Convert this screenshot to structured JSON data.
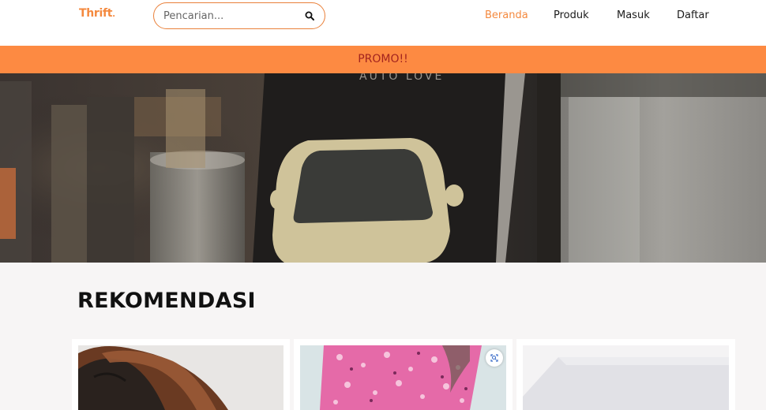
{
  "brand": {
    "name": "Thrift",
    "dot": ".",
    "color": "#f4893e"
  },
  "search": {
    "placeholder": "Pencarian...",
    "value": "",
    "icon": "search-icon"
  },
  "nav": {
    "items": [
      {
        "label": "Beranda",
        "active": true
      },
      {
        "label": "Produk",
        "active": false
      },
      {
        "label": "Masuk",
        "active": false
      },
      {
        "label": "Daftar",
        "active": false
      }
    ]
  },
  "promo": {
    "text": "PROMO!!",
    "bg_color": "#fd8a42",
    "text_color": "#a3241f"
  },
  "hero": {
    "image": "hero-banner-image"
  },
  "recommendations": {
    "title": "REKOMENDASI",
    "cards": [
      {
        "image": "product-image-headphones"
      },
      {
        "image": "product-image-floral-dress",
        "zoom_icon": "zoom-icon"
      },
      {
        "image": "product-image-white-item"
      }
    ]
  }
}
